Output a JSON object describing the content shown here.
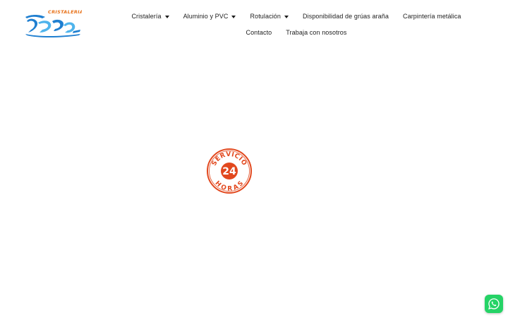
{
  "brand": {
    "logo_text": "CRISTALERIA",
    "logo_script": "Trebejo",
    "colors": {
      "orange": "#e8731c",
      "blue": "#1f7fd0",
      "light_blue": "#4fb4ec"
    }
  },
  "nav": {
    "items": [
      {
        "label": "Cristalería",
        "has_dropdown": true
      },
      {
        "label": "Aluminio y PVC",
        "has_dropdown": true
      },
      {
        "label": "Rotulación",
        "has_dropdown": true
      },
      {
        "label": "Disponibilidad de grúas araña",
        "has_dropdown": false
      },
      {
        "label": "Carpintería metálica",
        "has_dropdown": false
      },
      {
        "label": "Contacto",
        "has_dropdown": false
      },
      {
        "label": "Trabaja con nosotros",
        "has_dropdown": false
      }
    ]
  },
  "badge": {
    "top_text": "SERVICIO",
    "number": "24",
    "bottom_text": "HORAS",
    "color": "#e2481e"
  },
  "whatsapp": {
    "icon": "whatsapp-icon",
    "color": "#25d366"
  }
}
